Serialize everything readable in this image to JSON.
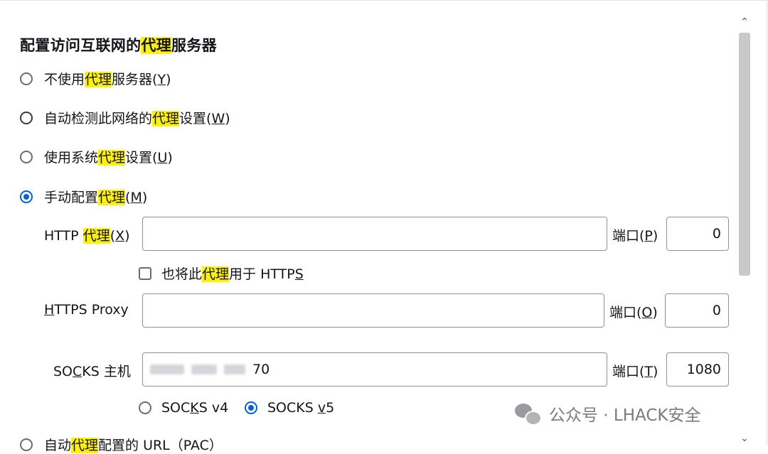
{
  "section": {
    "title_pre": "配置访问互联网的",
    "title_hl": "代理",
    "title_post": "服务器"
  },
  "options": {
    "no_proxy": {
      "pre": "不使用",
      "hl": "代理",
      "post": "服务器(",
      "key": "Y",
      "end": ")"
    },
    "auto_detect": {
      "pre": "自动检测此网络的",
      "hl": "代理",
      "post": "设置(",
      "key": "W",
      "end": ")"
    },
    "system": {
      "pre": "使用系统",
      "hl": "代理",
      "post": "设置(",
      "key": "U",
      "end": ")"
    },
    "manual": {
      "pre": "手动配置",
      "hl": "代理",
      "post": "(",
      "key": "M",
      "end": ")"
    },
    "pac": {
      "pre": "自动",
      "hl": "代理",
      "post": "配置的 URL（PAC）"
    }
  },
  "http": {
    "label_pre": "HTTP ",
    "label_hl": "代理",
    "label_post": "(",
    "label_key": "X",
    "label_end": ")",
    "value": "",
    "port_label_pre": "端口(",
    "port_label_key": "P",
    "port_label_end": ")",
    "port": "0"
  },
  "also_https": {
    "pre": "也将此",
    "hl": "代理",
    "post": "用于 HTTP",
    "key": "S"
  },
  "https": {
    "label_key": "H",
    "label_rest": "TTPS Proxy",
    "value": "",
    "port_label_pre": "端口(",
    "port_label_key": "O",
    "port_label_end": ")",
    "port": "0"
  },
  "socks": {
    "label_pre": "SO",
    "label_key": "C",
    "label_post": "KS 主机",
    "value_visible": "70",
    "port_label_pre": "端口(",
    "port_label_key": "T",
    "port_label_end": ")",
    "port": "1080",
    "v4_pre": "SOC",
    "v4_key": "K",
    "v4_post": "S v4",
    "v5_pre": "SOCKS ",
    "v5_key": "v",
    "v5_post": "5"
  },
  "watermark": {
    "text": "公众号 · LHACK安全"
  },
  "icons": {
    "scroll_up": "scroll-up-icon",
    "scroll_down": "scroll-down-icon",
    "wechat": "wechat-icon"
  }
}
